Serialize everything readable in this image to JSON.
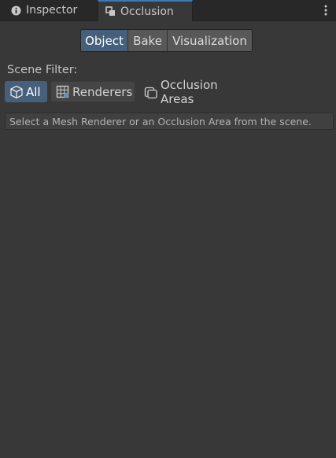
{
  "tabs": {
    "inspector": {
      "label": "Inspector",
      "icon": "info-icon"
    },
    "occlusion": {
      "label": "Occlusion",
      "icon": "occlusion-window-icon"
    },
    "menu_icon": "kebab-menu-icon"
  },
  "mode_toolbar": {
    "object": "Object",
    "bake": "Bake",
    "visualization": "Visualization",
    "active": "Object"
  },
  "scene_filter": {
    "label": "Scene Filter:",
    "all": {
      "label": "All",
      "icon": "cube-icon"
    },
    "renderers": {
      "label": "Renderers",
      "icon": "mesh-grid-icon"
    },
    "occlusion_areas": {
      "label": "Occlusion Areas",
      "icon": "occlusion-area-icon"
    },
    "active": "All"
  },
  "info_message": "Select a Mesh Renderer or an Occlusion Area from the scene.",
  "colors": {
    "background": "#383838",
    "tabbar": "#282828",
    "active_blue": "#46607c",
    "tab_accent": "#3a79bb"
  }
}
